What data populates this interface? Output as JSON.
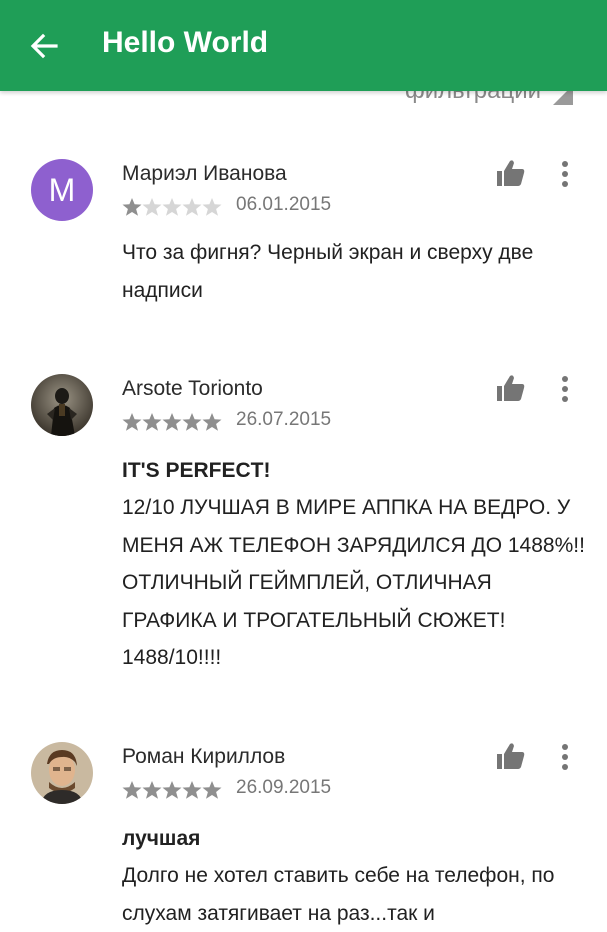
{
  "app_bar": {
    "title": "Hello World",
    "back_icon": "arrow-left-icon",
    "color": "#1f9e57"
  },
  "filter": {
    "label": "фильтрации",
    "icon": "dropdown-triangle-icon"
  },
  "reviews": [
    {
      "author": "Мариэл Иванова",
      "avatar_letter": "M",
      "avatar_color": "#8e60cf",
      "rating": 1,
      "date": "06.01.2015",
      "title": "",
      "text": "Что за фигня? Черный экран и сверху две надписи"
    },
    {
      "author": "Arsote Torionto",
      "avatar_letter": "",
      "rating": 5,
      "date": "26.07.2015",
      "title": "IT'S PERFECT!",
      "text": "12/10 ЛУЧШАЯ В МИРЕ АППКА НА ВЕДРО. У МЕНЯ АЖ ТЕЛЕФОН ЗАРЯДИЛСЯ ДО 1488%!! ОТЛИЧНЫЙ ГЕЙМПЛЕЙ, ОТЛИЧНАЯ ГРАФИКА И ТРОГАТЕЛЬНЫЙ СЮЖЕТ! 1488/10!!!!"
    },
    {
      "author": "Роман Кириллов",
      "avatar_letter": "",
      "rating": 5,
      "date": "26.09.2015",
      "title": "лучшая",
      "text": "Долго не хотел ставить себе на телефон, по слухам затягивает на раз...так и"
    }
  ],
  "icons": {
    "like": "thumbs-up-icon",
    "more": "more-vertical-icon",
    "star": "star-icon"
  },
  "colors": {
    "star_filled": "#8f8f8f",
    "star_empty": "#d6d6d6",
    "icon": "#757575"
  }
}
